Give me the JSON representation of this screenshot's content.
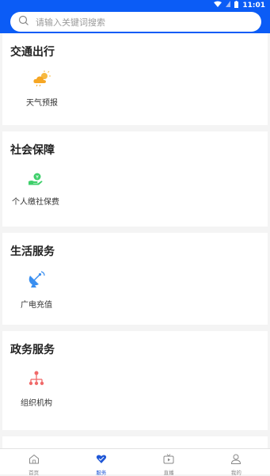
{
  "status": {
    "time": "11:01"
  },
  "search": {
    "placeholder": "请输入关键词搜索"
  },
  "sections": [
    {
      "title": "交通出行",
      "items": [
        {
          "label": "天气预报",
          "icon": "weather-icon",
          "color": "#f7b93f"
        }
      ]
    },
    {
      "title": "社会保障",
      "items": [
        {
          "label": "个人缴社保费",
          "icon": "hand-coin-icon",
          "color": "#3fcf6b"
        }
      ]
    },
    {
      "title": "生活服务",
      "items": [
        {
          "label": "广电充值",
          "icon": "satellite-dish-icon",
          "color": "#3a8ff0"
        }
      ]
    },
    {
      "title": "政务服务",
      "items": [
        {
          "label": "组织机构",
          "icon": "org-chart-icon",
          "color": "#f06a6a"
        }
      ]
    }
  ],
  "tabbar": {
    "tabs": [
      {
        "label": "首页",
        "icon": "home-icon"
      },
      {
        "label": "服务",
        "icon": "service-heart-icon",
        "active": true
      },
      {
        "label": "直播",
        "icon": "live-tv-icon"
      },
      {
        "label": "我的",
        "icon": "user-icon"
      }
    ],
    "active_color": "#1f57d6"
  },
  "colors": {
    "brand": "#0b5cf6"
  }
}
